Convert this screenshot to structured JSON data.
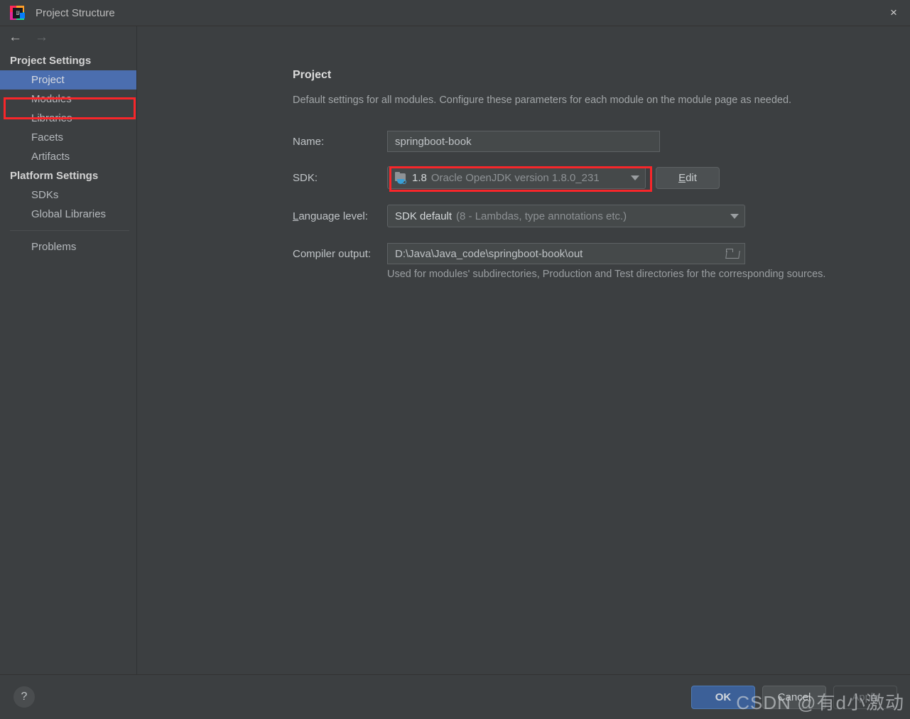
{
  "window": {
    "title": "Project Structure",
    "app_icon": "intellij-idea-icon",
    "app_icon_letters": "IJ",
    "close_label": "×"
  },
  "nav": {
    "back": "←",
    "forward": "→"
  },
  "sidebar": {
    "groups": [
      {
        "label": "Project Settings",
        "items": [
          {
            "label": "Project",
            "selected": true
          },
          {
            "label": "Modules",
            "selected": false
          },
          {
            "label": "Libraries",
            "selected": false
          },
          {
            "label": "Facets",
            "selected": false
          },
          {
            "label": "Artifacts",
            "selected": false
          }
        ]
      },
      {
        "label": "Platform Settings",
        "items": [
          {
            "label": "SDKs",
            "selected": false
          },
          {
            "label": "Global Libraries",
            "selected": false
          }
        ]
      }
    ],
    "extra_items": [
      {
        "label": "Problems",
        "selected": false
      }
    ]
  },
  "main": {
    "title": "Project",
    "description": "Default settings for all modules. Configure these parameters for each module on the module page as needed.",
    "fields": {
      "name": {
        "label": "Name:",
        "value": "springboot-book"
      },
      "sdk": {
        "label": "SDK:",
        "icon": "jdk-folder-icon",
        "value_primary": "1.8",
        "value_secondary": "Oracle OpenJDK version 1.8.0_231",
        "edit_button": "Edit",
        "edit_button_mnemonic": "E",
        "edit_button_rest": "dit"
      },
      "language_level": {
        "label": "Language level:",
        "label_mnemonic": "L",
        "label_rest": "anguage level:",
        "value_primary": "SDK default",
        "value_secondary": "(8 - Lambdas, type annotations etc.)"
      },
      "compiler_output": {
        "label": "Compiler output:",
        "value": "D:\\Java\\Java_code\\springboot-book\\out",
        "browse_icon": "folder-browse-icon",
        "hint": "Used for modules' subdirectories, Production and Test directories for the corresponding sources."
      }
    }
  },
  "footer": {
    "help": "?",
    "ok": "OK",
    "cancel": "Cancel",
    "apply": "Apply"
  },
  "watermark": "CSDN @有d小激动",
  "colors": {
    "background": "#3c3f41",
    "field_background": "#45494a",
    "selection_blue": "#4b6eaf",
    "primary_button": "#3c6098",
    "annotation_red": "#f8262a"
  }
}
